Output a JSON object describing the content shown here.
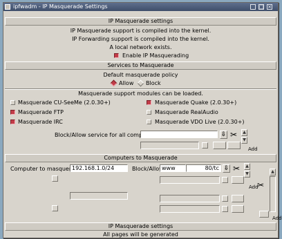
{
  "window": {
    "title": "ipfwadm - IP Masquerade Settings"
  },
  "section1": {
    "header": "IP Masquerade settings",
    "line1": "IP Masquerade support is compiled into the kernel.",
    "line2": "IP Forwarding support is compiled into the kernel.",
    "line3": "A local network exists.",
    "enable_label": "Enable IP Masquerading"
  },
  "services": {
    "header": "Services to Masquerade",
    "policy_label": "Default masquerade policy",
    "allow_label": "Allow",
    "block_label": "Block",
    "modules_label": "Masquerade support modules can be loaded.",
    "modules": [
      {
        "label": "Masquerade CU-SeeMe (2.0.30+)",
        "checked": false
      },
      {
        "label": "Masquerade Quake (2.0.30+)",
        "checked": true
      },
      {
        "label": "Masquerade FTP",
        "checked": true
      },
      {
        "label": "Masquerade RealAudio",
        "checked": false
      },
      {
        "label": "Masquerade IRC",
        "checked": true
      },
      {
        "label": "Masquerade VDO Live (2.0.30+)",
        "checked": false
      }
    ],
    "block_allow_label": "Block/Allow service for all computers",
    "add_label": "Add"
  },
  "computers": {
    "header": "Computers to Masquerade",
    "computer_label": "Computer to masquerade",
    "computer_value": "192.168.1.0/24",
    "block_allow_label": "Block/Allow",
    "service_value": "www",
    "port_value": "80/tc",
    "add_label": "Add"
  },
  "footer": {
    "header": "IP Masquerade settings",
    "status": "All pages will be generated"
  },
  "colors": {
    "checked": "#c23c48",
    "titlebar": "#4e5e7c",
    "background": "#d8d4cc"
  }
}
